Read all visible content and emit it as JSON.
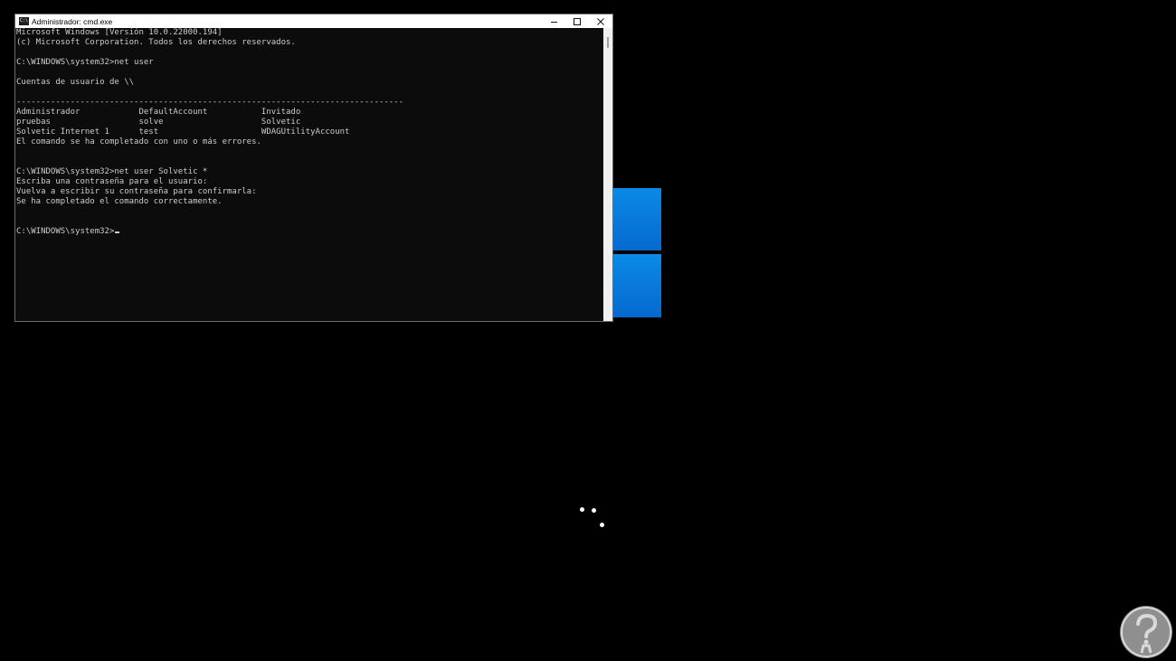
{
  "window": {
    "title": "Administrador: cmd.exe",
    "icon": "cmd-app-icon",
    "icon_glyph": "C:\\"
  },
  "controls": {
    "minimize_icon": "minimize-icon",
    "maximize_icon": "maximize-icon",
    "close_icon": "close-icon"
  },
  "console": {
    "lines": [
      "Microsoft Windows [Versión 10.0.22000.194]",
      "(c) Microsoft Corporation. Todos los derechos reservados.",
      "",
      "C:\\WINDOWS\\system32>net user",
      "",
      "Cuentas de usuario de \\\\",
      "",
      "-------------------------------------------------------------------------------",
      "Administrador            DefaultAccount           Invitado",
      "pruebas                  solve                    Solvetic",
      "Solvetic Internet 1      test                     WDAGUtilityAccount",
      "El comando se ha completado con uno o más errores.",
      "",
      "",
      "C:\\WINDOWS\\system32>net user Solvetic *",
      "Escriba una contraseña para el usuario:",
      "Vuelva a escribir su contraseña para confirmarla:",
      "Se ha completado el comando correctamente.",
      "",
      "",
      "C:\\WINDOWS\\system32>"
    ]
  },
  "background": {
    "logo_color": "#0a7ddb",
    "spinner": "loading-spinner"
  },
  "colors": {
    "console_bg": "#0c0c0c",
    "console_text": "#cccccc",
    "titlebar_bg": "#ffffff"
  }
}
